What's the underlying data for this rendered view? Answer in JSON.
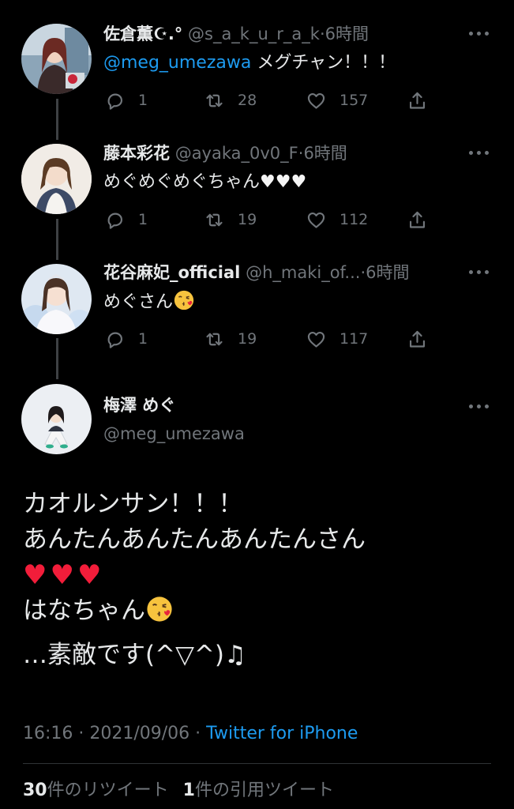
{
  "replies": [
    {
      "name": "佐倉薫☪︎.°",
      "handle": "@s_a_k_u_r_a_k",
      "time": "6時間",
      "mention": "@meg_umezawa",
      "text": " メグチャン！！！",
      "reply_count": "1",
      "retweet_count": "28",
      "like_count": "157"
    },
    {
      "name": "藤本彩花",
      "handle": "@ayaka_0v0_F",
      "time": "6時間",
      "text": "めぐめぐめぐちゃん",
      "hearts": "♥♥♥",
      "reply_count": "1",
      "retweet_count": "19",
      "like_count": "112"
    },
    {
      "name": "花谷麻妃_official",
      "handle": "@h_maki_of...",
      "time": "6時間",
      "text": "めぐさん",
      "reply_count": "1",
      "retweet_count": "19",
      "like_count": "117"
    }
  ],
  "main_tweet": {
    "name": "梅澤 めぐ",
    "handle": "@meg_umezawa",
    "lines": [
      "カオルンサン！！！",
      "あんたんあんたんあんたんさん",
      "♥♥♥",
      "はなちゃん",
      "…素敵です(^▽^)♫"
    ],
    "timestamp": "16:16 · 2021/09/06 · ",
    "source": "Twitter for iPhone",
    "retweets_count": "30",
    "retweets_label": "件のリツイート",
    "quotes_count": "1",
    "quotes_label": "件の引用ツイート"
  },
  "colors": {
    "background": "#000000",
    "accent": "#1d9bf0",
    "secondary_text": "#71767b",
    "heart_red": "#f21d3a"
  },
  "icons": [
    "reply-icon",
    "retweet-icon",
    "like-icon",
    "share-icon",
    "more-icon",
    "kiss-emoji",
    "music-note"
  ]
}
